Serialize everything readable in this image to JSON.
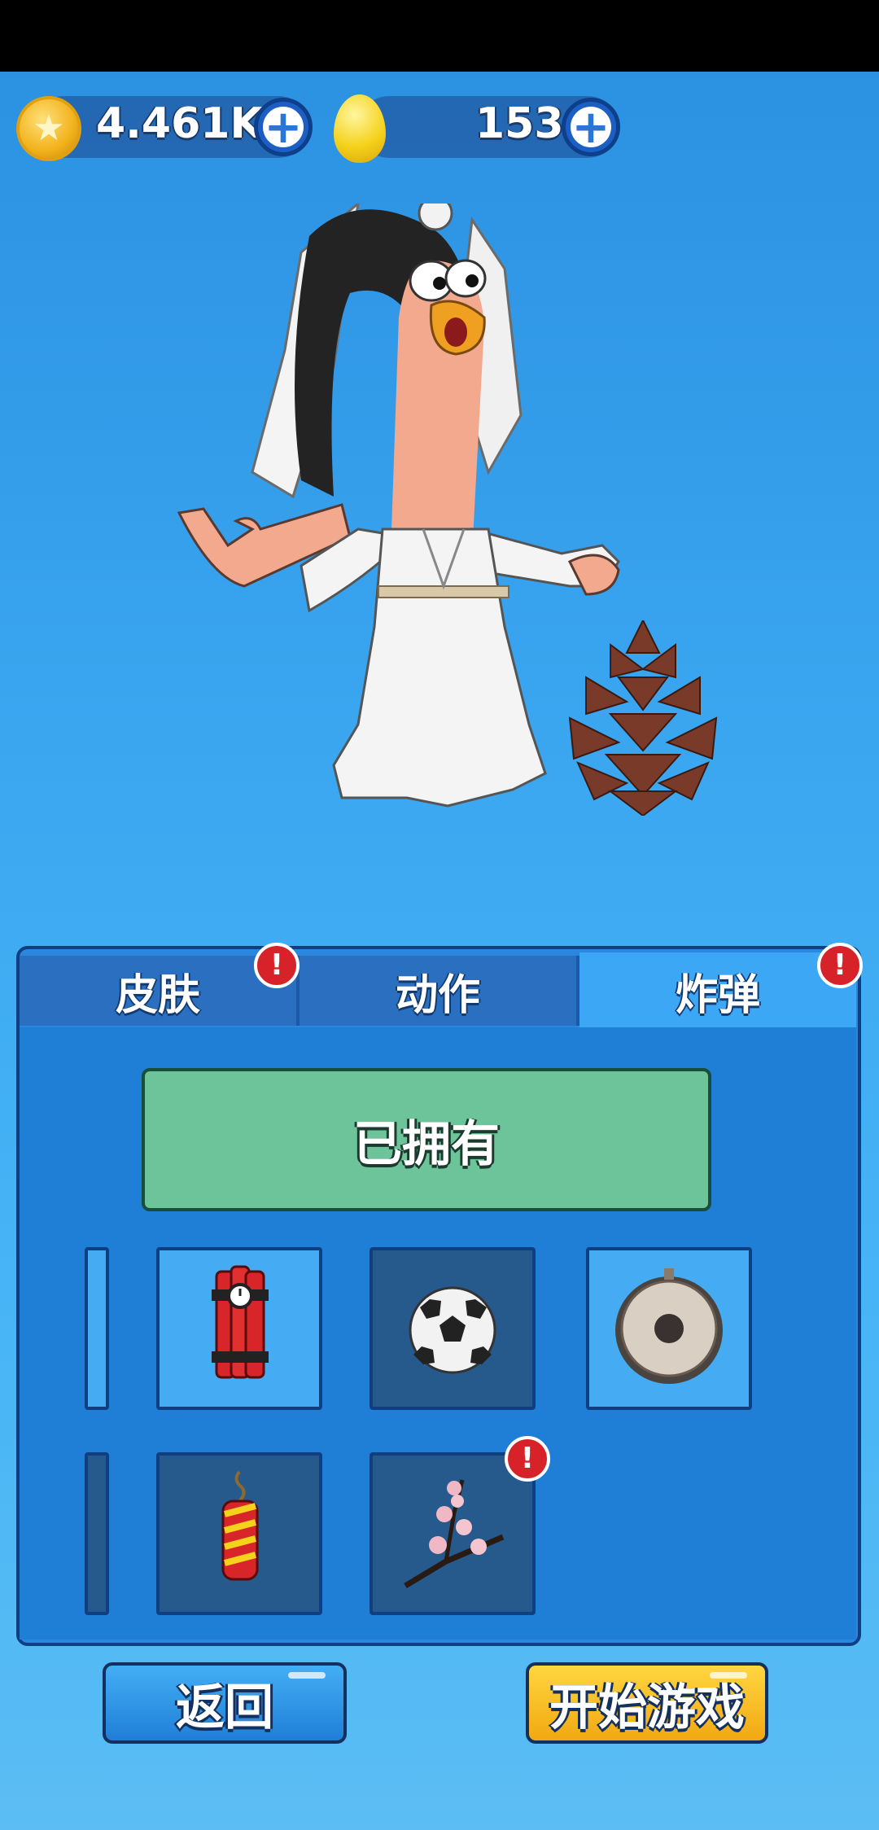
{
  "currency": {
    "coins": "4.461K",
    "eggs": "153",
    "plus": "+",
    "coin_symbol": "★"
  },
  "tabs": [
    {
      "label": "皮肤",
      "active": false,
      "alert": true
    },
    {
      "label": "动作",
      "active": false,
      "alert": false
    },
    {
      "label": "炸弹",
      "active": true,
      "alert": true
    }
  ],
  "status_label": "已拥有",
  "alert_symbol": "!",
  "items": [
    {
      "icon": "dynamite-bundle-icon",
      "selected": false
    },
    {
      "icon": "soccer-ball-icon",
      "selected": true
    },
    {
      "icon": "gong-icon",
      "selected": false
    },
    {
      "icon": "firecracker-icon",
      "selected": true
    },
    {
      "icon": "plum-blossom-branch-icon",
      "selected": true,
      "alert": true
    }
  ],
  "buttons": {
    "back": "返回",
    "start": "开始游戏"
  }
}
